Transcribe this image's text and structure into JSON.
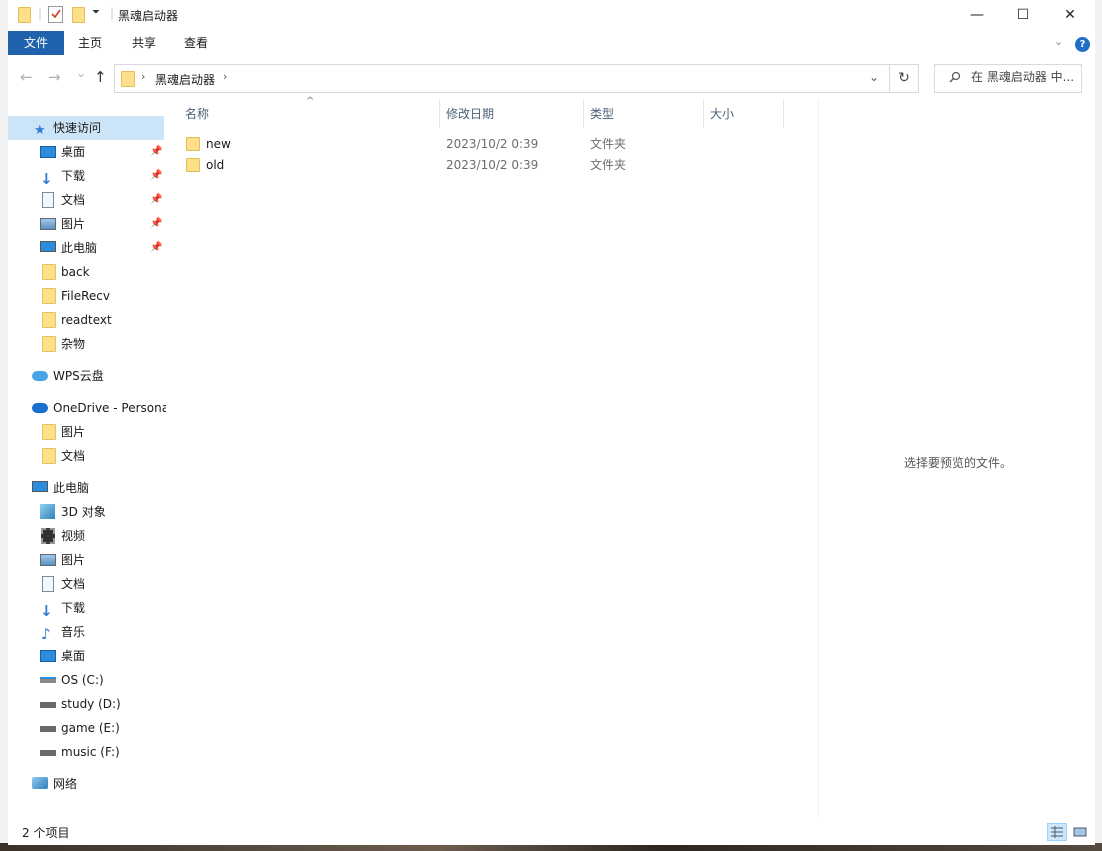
{
  "window": {
    "title": "黑魂启动器"
  },
  "title_controls": {
    "minimize": "—",
    "maximize": "☐",
    "close": "✕"
  },
  "ribbon": {
    "tabs": [
      "文件",
      "主页",
      "共享",
      "查看"
    ],
    "help": "?"
  },
  "nav": {
    "back": "←",
    "forward": "→",
    "recent": "⌄",
    "up": "↑",
    "breadcrumb": "黑魂启动器",
    "refresh": "↻",
    "search_placeholder": "在 黑魂启动器 中..."
  },
  "sidebar": {
    "quick_access": "快速访问",
    "quick_items": [
      {
        "label": "桌面",
        "pinned": true
      },
      {
        "label": "下载",
        "pinned": true
      },
      {
        "label": "文档",
        "pinned": true
      },
      {
        "label": "图片",
        "pinned": true
      },
      {
        "label": "此电脑",
        "pinned": true
      },
      {
        "label": "back",
        "pinned": false
      },
      {
        "label": "FileRecv",
        "pinned": false
      },
      {
        "label": "readtext",
        "pinned": false
      },
      {
        "label": "杂物",
        "pinned": false
      }
    ],
    "wps": "WPS云盘",
    "onedrive": "OneDrive - Persona",
    "onedrive_items": [
      "图片",
      "文档"
    ],
    "this_pc": "此电脑",
    "pc_items": [
      "3D 对象",
      "视频",
      "图片",
      "文档",
      "下载",
      "音乐",
      "桌面",
      "OS (C:)",
      "study (D:)",
      "game (E:)",
      "music (F:)"
    ],
    "network": "网络"
  },
  "columns": {
    "name": "名称",
    "date": "修改日期",
    "type": "类型",
    "size": "大小"
  },
  "files": [
    {
      "name": "new",
      "date": "2023/10/2 0:39",
      "type": "文件夹"
    },
    {
      "name": "old",
      "date": "2023/10/2 0:39",
      "type": "文件夹"
    }
  ],
  "preview_text": "选择要预览的文件。",
  "status": {
    "count": "2 个项目"
  },
  "colors": {
    "accent": "#1f63ac",
    "selection": "#cce4f7",
    "folder": "#ffe08a"
  }
}
